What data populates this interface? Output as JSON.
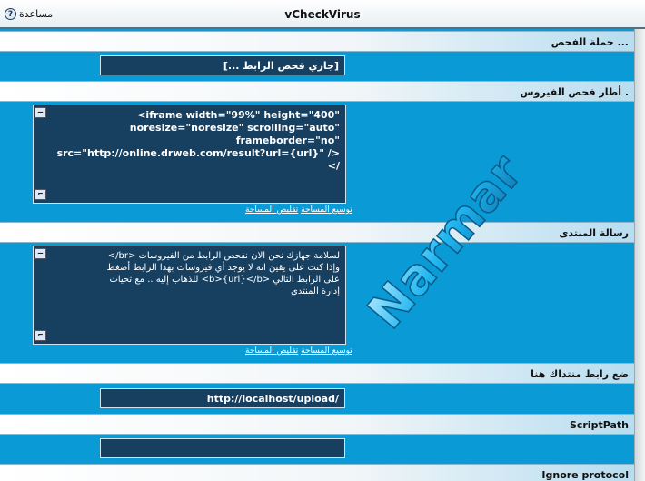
{
  "titlebar": {
    "title": "vCheckVirus",
    "help_label": "مساعدة",
    "help_glyph": "?"
  },
  "sections": {
    "campaign": {
      "heading": "حملة الفحص ...",
      "value": "[جاري فحص الرابط ...]"
    },
    "frame": {
      "heading": "أطار فحص الفيروس .",
      "code": "<iframe width=\"99%\" height=\"400\"\nnoresize=\"noresize\" scrolling=\"auto\"\nframeborder=\"no\"\nsrc=\"http://online.drweb.com/result?url={url}\" /></"
    },
    "message": {
      "heading": "رسالة المنتدى",
      "text": "لسلامة جهازك نحن الان نفحص الرابط من الفيروسات <br/>\nوإذا كنت على يقين انه لا يوجد أي فيروسات بهذا الرابط أضغط\nعلى الرابط التالي <b>{url}</b> للذهاب إليه .. مع تحيات\nإدارة المنتدى"
    },
    "forum_url": {
      "heading": "ضع رابط منتداك هنا",
      "value": "http://localhost/upload/"
    },
    "script_path": {
      "heading": "ScriptPath",
      "value": ""
    },
    "ignore_protocol": {
      "heading": "Ignore protocol"
    }
  },
  "resize": {
    "expand": "توسيع المساحة",
    "shrink": "تقليص المساحة"
  },
  "scroll": {
    "up_glyph": "–",
    "down_glyph": "⌐"
  },
  "watermark": {
    "text": "Narmar",
    "color": "#1fb6f0"
  }
}
